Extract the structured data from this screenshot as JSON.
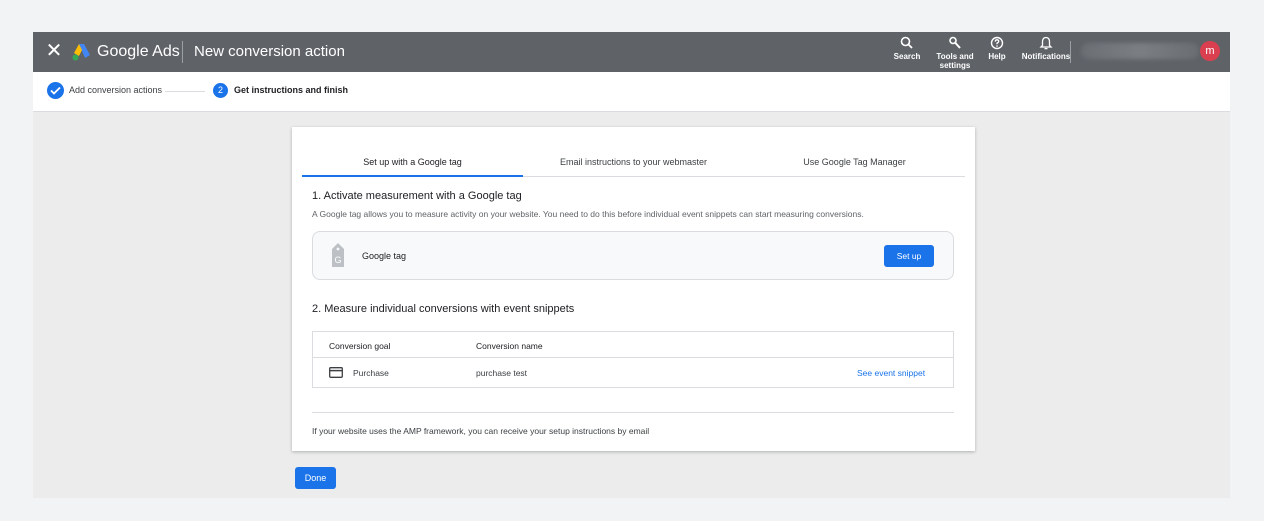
{
  "header": {
    "close_icon": "close-icon",
    "brand": "Google Ads",
    "title": "New conversion action",
    "tools": [
      {
        "icon": "search-icon",
        "label": "Search"
      },
      {
        "icon": "wrench-icon",
        "label": "Tools and settings"
      },
      {
        "icon": "help-icon",
        "label": "Help"
      },
      {
        "icon": "bell-icon",
        "label": "Notifications"
      }
    ],
    "avatar_letter": "m",
    "avatar_color": "#d93f4f"
  },
  "stepper": {
    "steps": [
      {
        "label": "Add conversion actions",
        "state": "complete"
      },
      {
        "number": "2",
        "label": "Get instructions and finish",
        "state": "current"
      }
    ]
  },
  "tabs": [
    {
      "label": "Set up with a Google tag",
      "selected": true
    },
    {
      "label": "Email instructions to your webmaster",
      "selected": false
    },
    {
      "label": "Use Google Tag Manager",
      "selected": false
    }
  ],
  "section1": {
    "title": "1. Activate measurement with a Google tag",
    "description": "A Google tag allows you to measure activity on your website. You need to do this before individual event snippets can start measuring conversions.",
    "tag_label": "Google tag",
    "button_label": "Set up"
  },
  "section2": {
    "title": "2. Measure individual conversions with event snippets",
    "columns": [
      "Conversion goal",
      "Conversion name"
    ],
    "rows": [
      {
        "goal": "Purchase",
        "name": "purchase test",
        "action": "See event snippet",
        "icon": "credit-card-icon"
      }
    ]
  },
  "footer_note": "If your website uses the AMP framework, you can receive your setup instructions by email",
  "done_label": "Done",
  "colors": {
    "primary": "#1a73e8",
    "topbar": "#5f6368"
  }
}
